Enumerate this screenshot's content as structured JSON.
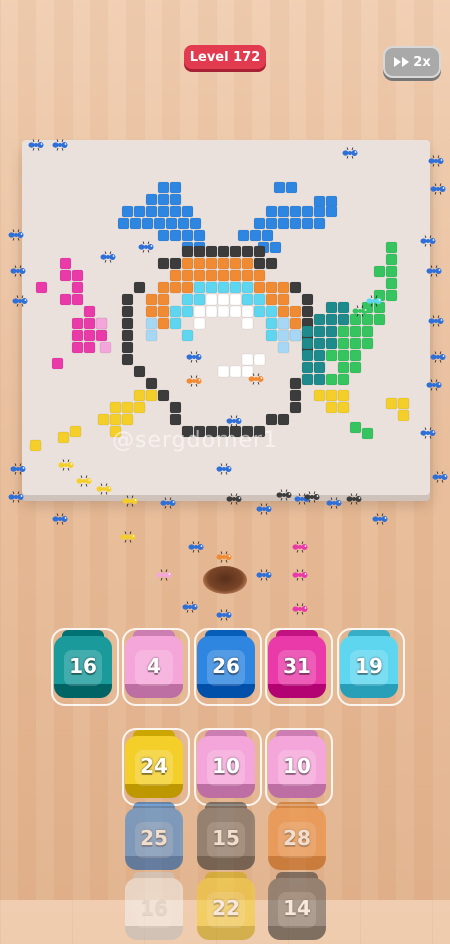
{
  "hud": {
    "level_label": "Level 172",
    "speed_label": "2x",
    "speed_icon": "fast-forward-icon"
  },
  "board": {
    "watermark": "@sergdomer1"
  },
  "colors": {
    "teal": "#1a9a9b",
    "pink": "#f4a6da",
    "blue": "#2f86e0",
    "magenta": "#ea3aa9",
    "cyan": "#5fd6f0",
    "yellow": "#f4cf2a",
    "gray": "#5b5b5b",
    "orange": "#f08a33",
    "white": "#f2f2f2"
  },
  "jars_row1": [
    {
      "count": "16",
      "color": "teal"
    },
    {
      "count": "4",
      "color": "pink"
    },
    {
      "count": "26",
      "color": "blue"
    },
    {
      "count": "31",
      "color": "magenta"
    },
    {
      "count": "19",
      "color": "cyan"
    }
  ],
  "jars_queue": [
    {
      "count": "24",
      "color": "yellow"
    },
    {
      "count": "10",
      "color": "pink"
    },
    {
      "count": "10",
      "color": "pink"
    },
    {
      "count": "25",
      "color": "blue"
    },
    {
      "count": "15",
      "color": "gray"
    },
    {
      "count": "28",
      "color": "orange"
    },
    {
      "count": "16",
      "color": "white"
    },
    {
      "count": "22",
      "color": "yellow"
    },
    {
      "count": "14",
      "color": "gray"
    }
  ]
}
